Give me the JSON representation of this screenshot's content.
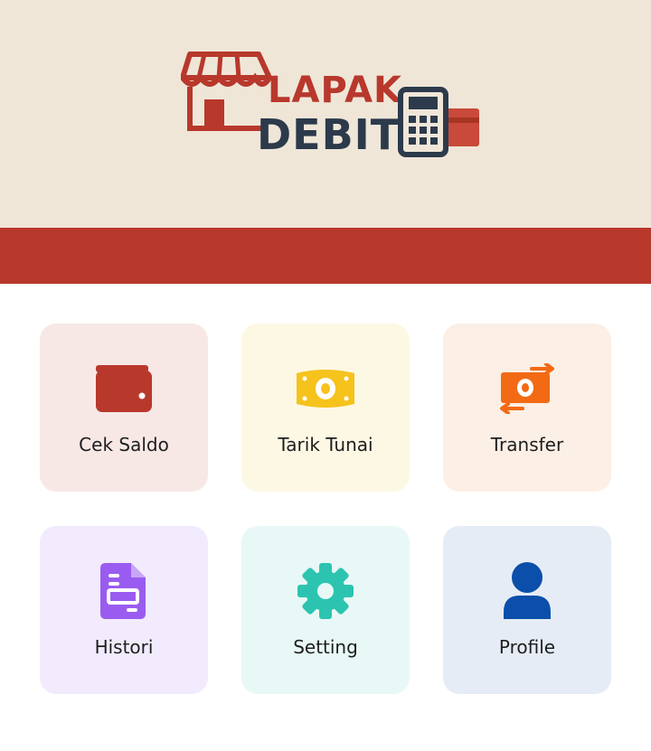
{
  "brand": {
    "line1": "LAPAK",
    "line2": "DEBIT",
    "primary_color": "#b8382c",
    "secondary_color": "#2c3a4b"
  },
  "menu": {
    "items": [
      {
        "label": "Cek Saldo",
        "icon": "wallet-icon",
        "color": "#b8382c"
      },
      {
        "label": "Tarik Tunai",
        "icon": "cash-icon",
        "color": "#f6c21c"
      },
      {
        "label": "Transfer",
        "icon": "money-transfer-icon",
        "color": "#f26a14"
      },
      {
        "label": "Histori",
        "icon": "document-icon",
        "color": "#9a5cf0"
      },
      {
        "label": "Setting",
        "icon": "gear-icon",
        "color": "#2cc4b0"
      },
      {
        "label": "Profile",
        "icon": "user-icon",
        "color": "#0b4faa"
      }
    ]
  }
}
